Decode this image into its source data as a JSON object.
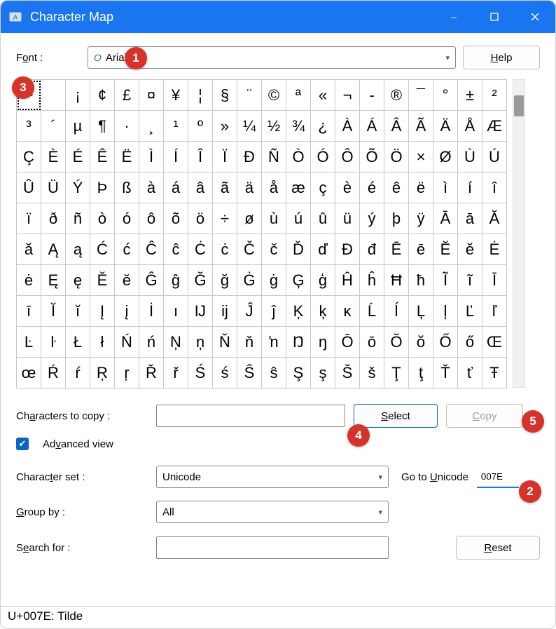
{
  "window": {
    "title": "Character Map",
    "buttons": {
      "minimize": "–",
      "maximize": "▢",
      "close": "✕"
    }
  },
  "font_row": {
    "label_pre": "F",
    "label_u": "o",
    "label_post": "nt :",
    "value": "Arial",
    "help_pre": "",
    "help_u": "H",
    "help_post": "elp"
  },
  "grid_chars": [
    "~",
    " ",
    "¡",
    "¢",
    "£",
    "¤",
    "¥",
    "¦",
    "§",
    "¨",
    "©",
    "ª",
    "«",
    "¬",
    "-",
    "®",
    "¯",
    "°",
    "±",
    "²",
    "³",
    "´",
    "µ",
    "¶",
    "·",
    "¸",
    "¹",
    "º",
    "»",
    "¼",
    "½",
    "¾",
    "¿",
    "À",
    "Á",
    "Â",
    "Ã",
    "Ä",
    "Å",
    "Æ",
    "Ç",
    "È",
    "É",
    "Ê",
    "Ë",
    "Ì",
    "Í",
    "Î",
    "Ï",
    "Ð",
    "Ñ",
    "Ò",
    "Ó",
    "Ô",
    "Õ",
    "Ö",
    "×",
    "Ø",
    "Ù",
    "Ú",
    "Û",
    "Ü",
    "Ý",
    "Þ",
    "ß",
    "à",
    "á",
    "â",
    "ã",
    "ä",
    "å",
    "æ",
    "ç",
    "è",
    "é",
    "ê",
    "ë",
    "ì",
    "í",
    "î",
    "ï",
    "ð",
    "ñ",
    "ò",
    "ó",
    "ô",
    "õ",
    "ö",
    "÷",
    "ø",
    "ù",
    "ú",
    "û",
    "ü",
    "ý",
    "þ",
    "ÿ",
    "Ā",
    "ā",
    "Ă",
    "ă",
    "Ą",
    "ą",
    "Ć",
    "ć",
    "Ĉ",
    "ĉ",
    "Ċ",
    "ċ",
    "Č",
    "č",
    "Ď",
    "ď",
    "Đ",
    "đ",
    "Ē",
    "ē",
    "Ĕ",
    "ĕ",
    "Ė",
    "ė",
    "Ę",
    "ę",
    "Ě",
    "ě",
    "Ĝ",
    "ĝ",
    "Ğ",
    "ğ",
    "Ġ",
    "ġ",
    "Ģ",
    "ģ",
    "Ĥ",
    "ĥ",
    "Ħ",
    "ħ",
    "Ĩ",
    "ĩ",
    "Ī",
    "ī",
    "Ĭ",
    "ĭ",
    "Į",
    "į",
    "İ",
    "ı",
    "Ĳ",
    "ĳ",
    "Ĵ",
    "ĵ",
    "Ķ",
    "ķ",
    "ĸ",
    "Ĺ",
    "ĺ",
    "Ļ",
    "ļ",
    "Ľ",
    "ľ",
    "Ŀ",
    "ŀ",
    "Ł",
    "ł",
    "Ń",
    "ń",
    "Ņ",
    "ņ",
    "Ň",
    "ň",
    "ŉ",
    "Ŋ",
    "ŋ",
    "Ō",
    "ō",
    "Ŏ",
    "ŏ",
    "Ő",
    "ő",
    "Œ",
    "œ",
    "Ŕ",
    "ŕ",
    "Ŗ",
    "ŗ",
    "Ř",
    "ř",
    "Ś",
    "ś",
    "Ŝ",
    "ŝ",
    "Ş",
    "ş",
    "Š",
    "š",
    "Ţ",
    "ţ",
    "Ť",
    "ť",
    "Ŧ"
  ],
  "selected_index": 0,
  "copy_row": {
    "label_pre": "Ch",
    "label_u": "a",
    "label_post": "racters to copy :",
    "select_u": "S",
    "select_post": "elect",
    "copy_u": "C",
    "copy_post": "opy"
  },
  "advanced": {
    "label_pre": "Ad",
    "label_u": "v",
    "label_post": "anced view"
  },
  "charset": {
    "label_pre": "Charac",
    "label_u": "t",
    "label_post": "er set :",
    "value": "Unicode",
    "goto_pre": "Go to ",
    "goto_u": "U",
    "goto_post": "nicode",
    "goto_value": "007E"
  },
  "groupby": {
    "label_u": "G",
    "label_post": "roup by :",
    "value": "All"
  },
  "search": {
    "label_pre": "S",
    "label_u": "e",
    "label_post": "arch for :",
    "reset_u": "R",
    "reset_post": "eset"
  },
  "status": "U+007E: Tilde",
  "annotations": {
    "a1": "1",
    "a2": "2",
    "a3": "3",
    "a4": "4",
    "a5": "5"
  }
}
